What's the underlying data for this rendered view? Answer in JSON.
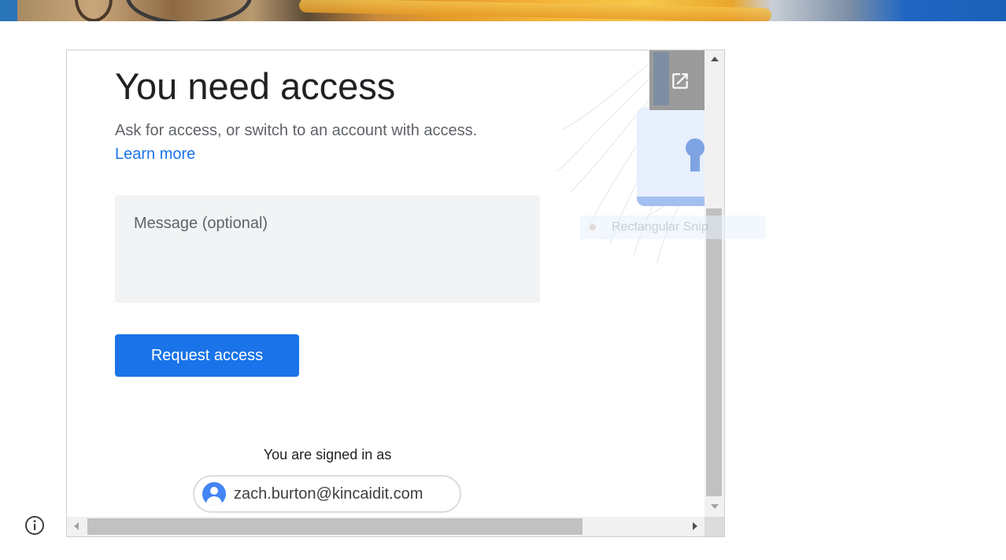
{
  "page": {
    "title": "You need access",
    "subtitle": "Ask for access, or switch to an account with access.",
    "learn_more": "Learn more",
    "message_placeholder": "Message (optional)",
    "request_button": "Request access",
    "signed_in_label": "You are signed in as",
    "account_email": "zach.burton@kincaidit.com"
  },
  "overlay": {
    "ghost_label": "Rectangular Snip"
  },
  "icons": {
    "popout": "open-in-new-icon",
    "info": "info-icon",
    "avatar": "account-avatar-icon"
  },
  "colors": {
    "accent": "#1a73e8",
    "title": "#202124",
    "muted": "#5f6368"
  }
}
